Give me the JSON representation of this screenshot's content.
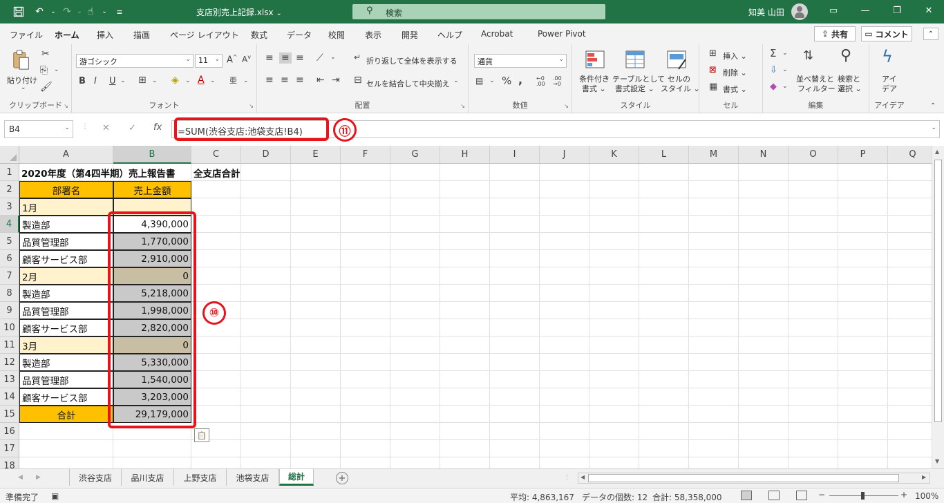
{
  "titlebar": {
    "filename": "支店別売上記録.xlsx",
    "dropdown": "⌄",
    "search_placeholder": "検索",
    "user": "知美 山田"
  },
  "menu": {
    "tabs": [
      "ファイル",
      "ホーム",
      "挿入",
      "描画",
      "ページ レイアウト",
      "数式",
      "データ",
      "校閲",
      "表示",
      "開発",
      "ヘルプ",
      "Acrobat",
      "Power Pivot"
    ],
    "share": "共有",
    "comment": "コメント"
  },
  "ribbon": {
    "clipboard": {
      "paste": "貼り付け",
      "label": "クリップボード"
    },
    "font": {
      "name": "游ゴシック",
      "size": "11",
      "label": "フォント"
    },
    "alignment": {
      "wrap": "折り返して全体を表示する",
      "merge": "セルを結合して中央揃え",
      "label": "配置"
    },
    "number": {
      "format": "通貨",
      "label": "数値"
    },
    "styles": {
      "conditional": "条件付き",
      "conditional2": "書式",
      "table": "テーブルとして",
      "table2": "書式設定",
      "cell": "セルの",
      "cell2": "スタイル",
      "label": "スタイル"
    },
    "cells": {
      "insert": "挿入",
      "delete": "削除",
      "format": "書式",
      "label": "セル"
    },
    "editing": {
      "sort": "並べ替えと",
      "sort2": "フィルター",
      "find": "検索と",
      "find2": "選択",
      "label": "編集"
    },
    "ideas": {
      "name": "アイ",
      "name2": "デア",
      "label": "アイデア"
    }
  },
  "formula_bar": {
    "namebox": "B4",
    "formula": "=SUM(渋谷支店:池袋支店!B4)",
    "callout_badge": "⑪"
  },
  "grid": {
    "columns": [
      "A",
      "B",
      "C",
      "D",
      "E",
      "F",
      "G",
      "H",
      "I",
      "J",
      "K",
      "L",
      "M",
      "N",
      "O",
      "P",
      "Q"
    ],
    "rows": [
      "1",
      "2",
      "3",
      "4",
      "5",
      "6",
      "7",
      "8",
      "9",
      "10",
      "11",
      "12",
      "13",
      "14",
      "15",
      "16",
      "17",
      "18"
    ],
    "title": "2020年度（第4四半期）売上報告書",
    "title_c": "全支店合計",
    "header_a": "部署名",
    "header_b": "売上金額",
    "a_values": [
      "1月",
      "製造部",
      "品質管理部",
      "顧客サービス部",
      "2月",
      "製造部",
      "品質管理部",
      "顧客サービス部",
      "3月",
      "製造部",
      "品質管理部",
      "顧客サービス部",
      "合計"
    ],
    "b_values": [
      "",
      "4,390,000",
      "1,770,000",
      "2,910,000",
      "0",
      "5,218,000",
      "1,998,000",
      "2,820,000",
      "0",
      "5,330,000",
      "1,540,000",
      "3,203,000",
      "29,179,000"
    ],
    "selection_badge": "⑩"
  },
  "sheets": {
    "tabs": [
      "渋谷支店",
      "品川支店",
      "上野支店",
      "池袋支店",
      "総計"
    ],
    "active": "総計"
  },
  "status": {
    "ready": "準備完了",
    "average": "平均: 4,863,167",
    "count": "データの個数: 12",
    "sum": "合計: 58,358,000",
    "zoom": "100%"
  },
  "colors": {
    "excel_green": "#217346",
    "header_fill": "#ffc000",
    "month_fill": "#fff2cc",
    "callout_red": "#e8141b"
  }
}
